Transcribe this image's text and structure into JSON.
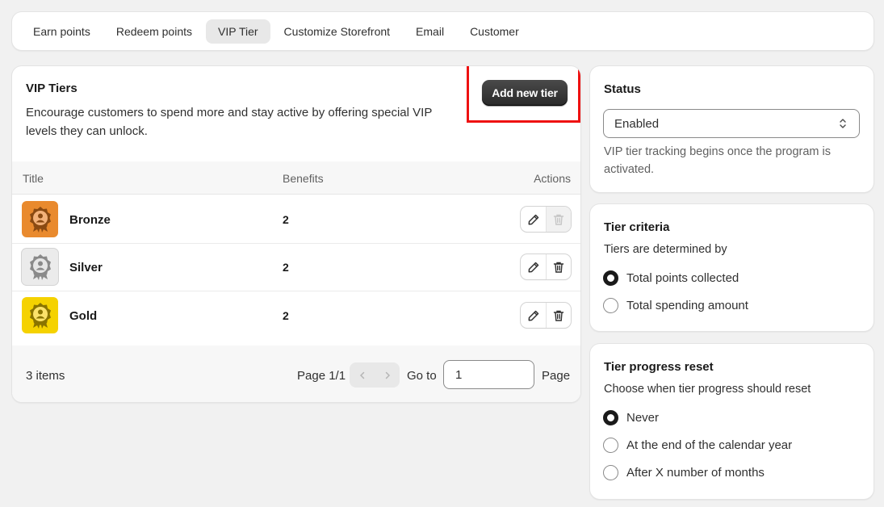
{
  "tabs": [
    "Earn points",
    "Redeem points",
    "VIP Tier",
    "Customize Storefront",
    "Email",
    "Customer"
  ],
  "active_tab": "VIP Tier",
  "vip": {
    "title": "VIP Tiers",
    "description": "Encourage customers to spend more and stay active by offering special VIP levels they can unlock.",
    "add_button": "Add new tier",
    "columns": {
      "title": "Title",
      "benefits": "Benefits",
      "actions": "Actions"
    },
    "rows": [
      {
        "name": "Bronze",
        "benefits": "2",
        "color": "#e98a2e",
        "delete_disabled": true
      },
      {
        "name": "Silver",
        "benefits": "2",
        "color": "#d9d9d9",
        "delete_disabled": false
      },
      {
        "name": "Gold",
        "benefits": "2",
        "color": "#f5d200",
        "delete_disabled": false
      }
    ],
    "footer": {
      "items_count": "3 items",
      "page_label": "Page 1/1",
      "goto_label": "Go to",
      "goto_value": "1",
      "page_suffix": "Page"
    }
  },
  "status": {
    "title": "Status",
    "selected": "Enabled",
    "help": "VIP tier tracking begins once the program is activated."
  },
  "criteria": {
    "title": "Tier criteria",
    "subtitle": "Tiers are determined by",
    "options": [
      "Total points collected",
      "Total spending amount"
    ],
    "selected_index": 0
  },
  "reset": {
    "title": "Tier progress reset",
    "subtitle": "Choose when tier progress should reset",
    "options": [
      "Never",
      "At the end of the calendar year",
      "After X number of months"
    ],
    "selected_index": 0
  },
  "colors": {
    "highlight": "#ee1111",
    "primary_button": "#303030"
  }
}
